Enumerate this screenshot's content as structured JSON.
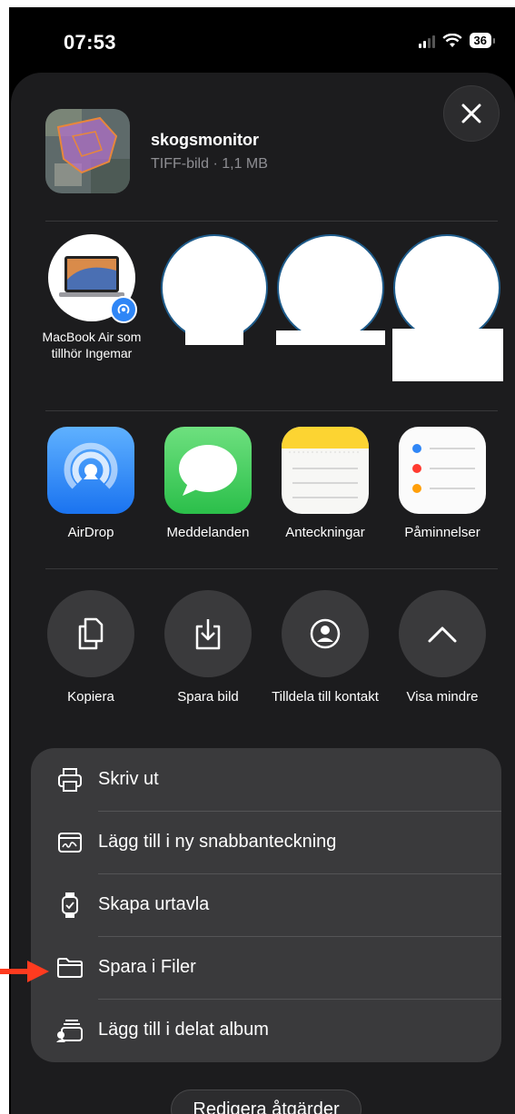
{
  "status": {
    "time": "07:53",
    "battery": "36"
  },
  "file": {
    "name": "skogsmonitor",
    "meta": "TIFF-bild · 1,1 MB"
  },
  "people": [
    {
      "label": "MacBook Air som tillhör Ingemar"
    }
  ],
  "apps": [
    {
      "label": "AirDrop",
      "icon": "airdrop-icon"
    },
    {
      "label": "Meddelanden",
      "icon": "messages-icon"
    },
    {
      "label": "Anteckningar",
      "icon": "notes-icon"
    },
    {
      "label": "Påminnelser",
      "icon": "reminders-icon"
    }
  ],
  "actions": [
    {
      "label": "Kopiera",
      "icon": "copy-icon"
    },
    {
      "label": "Spara bild",
      "icon": "save-image-icon"
    },
    {
      "label": "Tilldela till kontakt",
      "icon": "contact-icon"
    },
    {
      "label": "Visa mindre",
      "icon": "chevron-up-icon"
    }
  ],
  "menu": [
    {
      "label": "Skriv ut",
      "icon": "printer-icon"
    },
    {
      "label": "Lägg till i ny snabbanteckning",
      "icon": "quick-note-icon"
    },
    {
      "label": "Skapa urtavla",
      "icon": "watch-icon"
    },
    {
      "label": "Spara i Filer",
      "icon": "folder-icon"
    },
    {
      "label": "Lägg till i delat album",
      "icon": "shared-album-icon"
    }
  ],
  "edit_actions_label": "Redigera åtgärder",
  "colors": {
    "sheet": "#1c1c1e",
    "menu": "#3a3a3c",
    "arrow": "#ff3b1f",
    "airdrop_blue": "#2f86f6",
    "messages_green": "#34c759"
  }
}
